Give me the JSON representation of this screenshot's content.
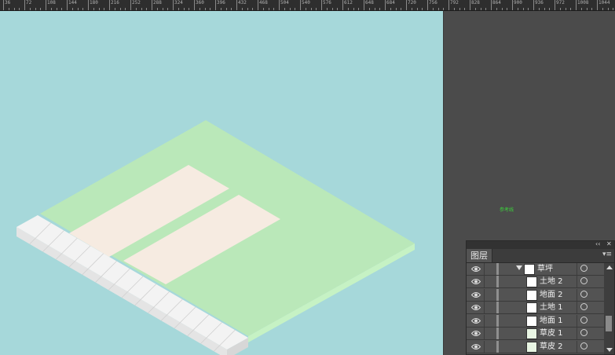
{
  "ruler": {
    "labels": [
      "36",
      "72",
      "108",
      "144",
      "180",
      "216",
      "252",
      "288",
      "324",
      "360",
      "396",
      "432",
      "468",
      "504",
      "540",
      "576",
      "612",
      "648",
      "684",
      "720",
      "756",
      "792",
      "828",
      "864",
      "900",
      "936",
      "972",
      "1008",
      "1044"
    ]
  },
  "canvas": {
    "background_color": "#a6d8da",
    "lawn_top_color": "#bae8b9",
    "lawn_side_color": "#c6f2c4",
    "ground_color": "#f6ebe1",
    "curb_color": "#f1f1f1"
  },
  "pasteboard": {
    "guide_label": "参考线"
  },
  "layers_panel": {
    "collapse_icon": "double-chevron-left-icon",
    "close_label": "✕",
    "tab_label": "图层",
    "menu_icon": "panel-menu-icon",
    "group": {
      "name": "草坪",
      "expanded": true
    },
    "layers": [
      {
        "name": "土地 2",
        "thumb": "white"
      },
      {
        "name": "地面 2",
        "thumb": "white"
      },
      {
        "name": "土地 1",
        "thumb": "white"
      },
      {
        "name": "地面 1",
        "thumb": "white"
      },
      {
        "name": "草皮 1",
        "thumb": "green"
      },
      {
        "name": "草皮 2",
        "thumb": "green"
      }
    ]
  }
}
